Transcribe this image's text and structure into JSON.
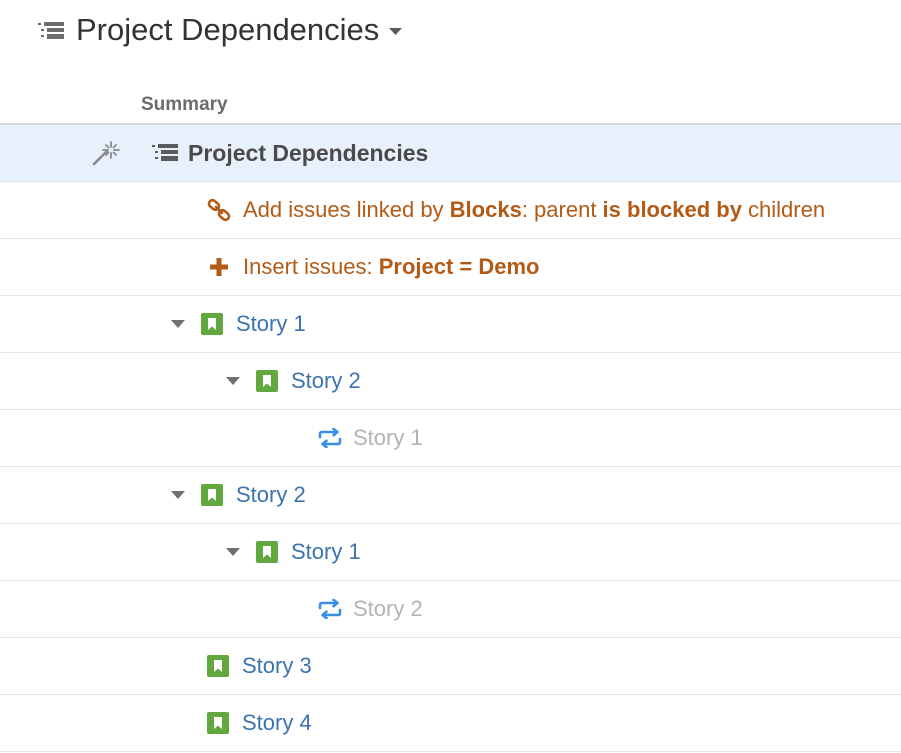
{
  "header": {
    "title": "Project Dependencies",
    "icon": "structure-icon",
    "dropdown_icon": "caret-down-icon"
  },
  "columns": {
    "summary": "Summary"
  },
  "rows": {
    "root": {
      "label": "Project Dependencies",
      "automation_icon": "magic-wand-icon"
    },
    "generator_links": {
      "prefix": "Add issues linked by ",
      "link_type": "Blocks",
      "middle": ": parent ",
      "direction": "is blocked by",
      "suffix": " children"
    },
    "generator_insert": {
      "prefix": "Insert issues: ",
      "query": "Project = Demo"
    },
    "issues": [
      {
        "label": "Story 1",
        "level": 0,
        "expanded": true
      },
      {
        "label": "Story 2",
        "level": 1,
        "expanded": true
      },
      {
        "label": "Story 1",
        "level": 2,
        "duplicate": true
      },
      {
        "label": "Story 2",
        "level": 0,
        "expanded": true
      },
      {
        "label": "Story 1",
        "level": 1,
        "expanded": true
      },
      {
        "label": "Story 2",
        "level": 2,
        "duplicate": true
      },
      {
        "label": "Story 3",
        "level": 0
      },
      {
        "label": "Story 4",
        "level": 0
      }
    ]
  },
  "colors": {
    "link": "#3b73af",
    "generator": "#b35b16",
    "story_icon": "#63a83e",
    "duplicate_text": "#b3b3b3",
    "duplicate_icon": "#3b8ee6",
    "selected_row": "#e8f0fc"
  }
}
